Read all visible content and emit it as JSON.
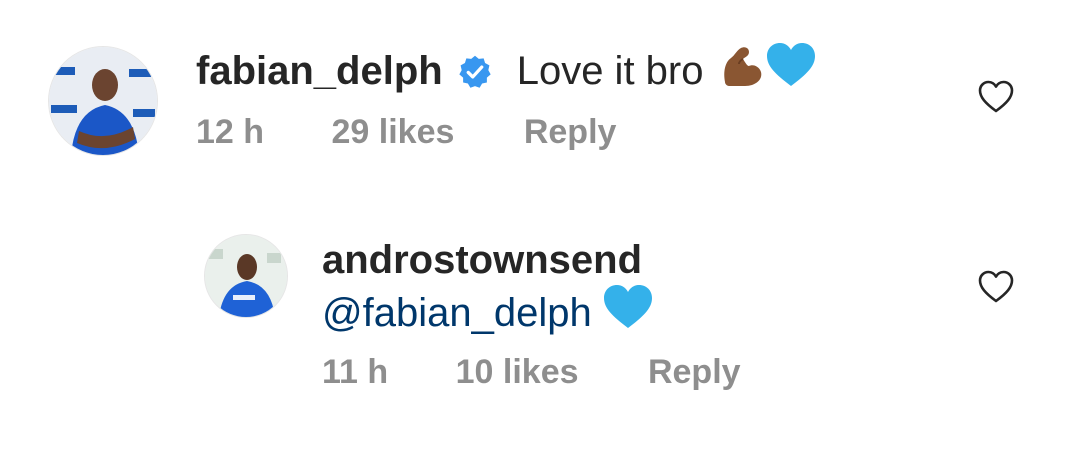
{
  "comments": [
    {
      "username": "fabian_delph",
      "verified": true,
      "text": "Love it bro",
      "emojis": [
        "flexed-biceps-medium-dark",
        "light-blue-heart"
      ],
      "time": "12 h",
      "likes": "29 likes",
      "reply_label": "Reply"
    },
    {
      "username": "androstownsend",
      "verified": false,
      "mention": "@fabian_delph",
      "emojis": [
        "light-blue-heart"
      ],
      "time": "11 h",
      "likes": "10 likes",
      "reply_label": "Reply"
    }
  ],
  "colors": {
    "text": "#262626",
    "meta": "#8e8e8e",
    "mention": "#00376b",
    "verified": "#3897f0",
    "heart_emoji": "#34b1ea",
    "arm_emoji": "#8a5632"
  }
}
